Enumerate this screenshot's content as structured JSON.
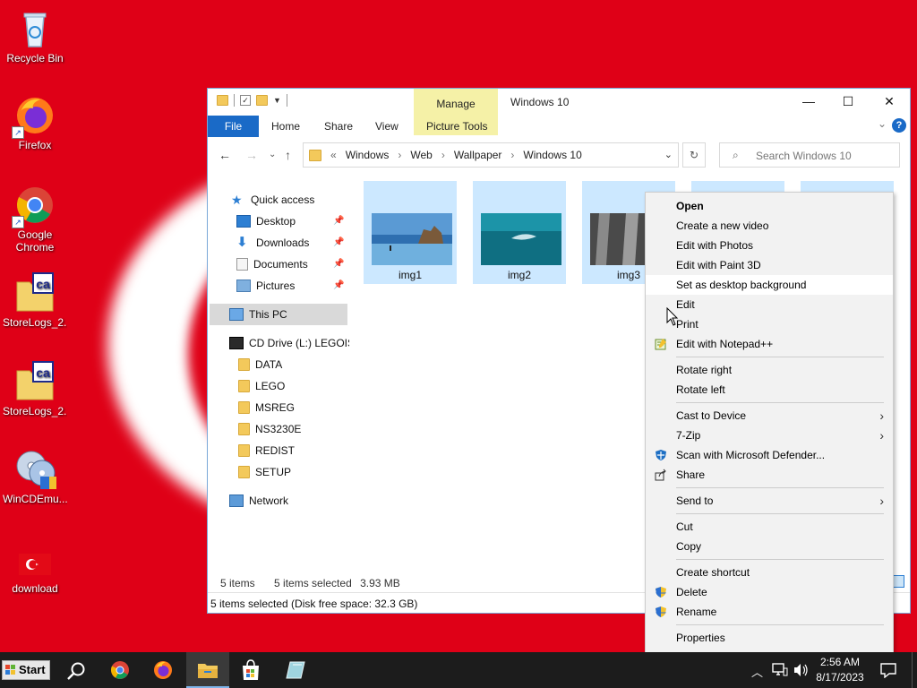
{
  "desktop": {
    "background_color": "#df0017",
    "icons": [
      {
        "label": "Recycle Bin",
        "icon": "recycle-bin-icon"
      },
      {
        "label": "Firefox",
        "icon": "firefox-icon"
      },
      {
        "label": "Google Chrome",
        "icon": "chrome-icon"
      },
      {
        "label": "StoreLogs_2...",
        "icon": "ca-file-icon"
      },
      {
        "label": "StoreLogs_2...",
        "icon": "ca-file-icon"
      },
      {
        "label": "WinCDEmu...",
        "icon": "wincdemu-icon"
      },
      {
        "label": "download",
        "icon": "turkey-flag-icon"
      }
    ]
  },
  "window": {
    "title": "Windows 10",
    "manage_label": "Manage",
    "ribbon_tabs": [
      "File",
      "Home",
      "Share",
      "View",
      "Picture Tools"
    ],
    "controls": {
      "minimize": "—",
      "maximize": "☐",
      "close": "✕"
    },
    "breadcrumb": {
      "prefix": "«",
      "items": [
        "Windows",
        "Web",
        "Wallpaper",
        "Windows 10"
      ]
    },
    "search_placeholder": "Search Windows 10",
    "nav": {
      "quick_access": "Quick access",
      "pinned": [
        "Desktop",
        "Downloads",
        "Documents",
        "Pictures"
      ],
      "this_pc": "This PC",
      "cd_drive": "CD Drive (L:) LEGOISL",
      "folders": [
        "DATA",
        "LEGO",
        "MSREG",
        "NS3230E",
        "REDIST",
        "SETUP"
      ],
      "network": "Network"
    },
    "files": [
      {
        "name": "img1"
      },
      {
        "name": "img2"
      },
      {
        "name": "img3"
      }
    ],
    "status": {
      "count": "5 items",
      "selected": "5 items selected",
      "size": "3.93 MB"
    },
    "bottom_status": "5 items selected (Disk free space: 32.3 GB)"
  },
  "context_menu": {
    "items": [
      {
        "label": "Open",
        "bold": true
      },
      {
        "label": "Create a new video"
      },
      {
        "label": "Edit with Photos"
      },
      {
        "label": "Edit with Paint 3D"
      },
      {
        "label": "Set as desktop background",
        "highlighted": true
      },
      {
        "label": "Edit"
      },
      {
        "label": "Print"
      },
      {
        "label": "Edit with Notepad++",
        "icon": "notepad-plus-icon"
      },
      {
        "label": "Rotate right"
      },
      {
        "label": "Rotate left"
      },
      {
        "label": "Cast to Device",
        "submenu": true
      },
      {
        "label": "7-Zip",
        "submenu": true
      },
      {
        "label": "Scan with Microsoft Defender...",
        "icon": "defender-icon"
      },
      {
        "label": "Share",
        "icon": "share-icon"
      },
      {
        "label": "Send to",
        "submenu": true
      },
      {
        "label": "Cut"
      },
      {
        "label": "Copy"
      },
      {
        "label": "Create shortcut"
      },
      {
        "label": "Delete",
        "icon": "uac-shield-icon"
      },
      {
        "label": "Rename",
        "icon": "uac-shield-icon"
      },
      {
        "label": "Properties"
      }
    ],
    "submenu_arrow": "›"
  },
  "taskbar": {
    "start_label": "Start",
    "clock_time": "2:56 AM",
    "clock_date": "8/17/2023",
    "tray_chevron": "^"
  }
}
